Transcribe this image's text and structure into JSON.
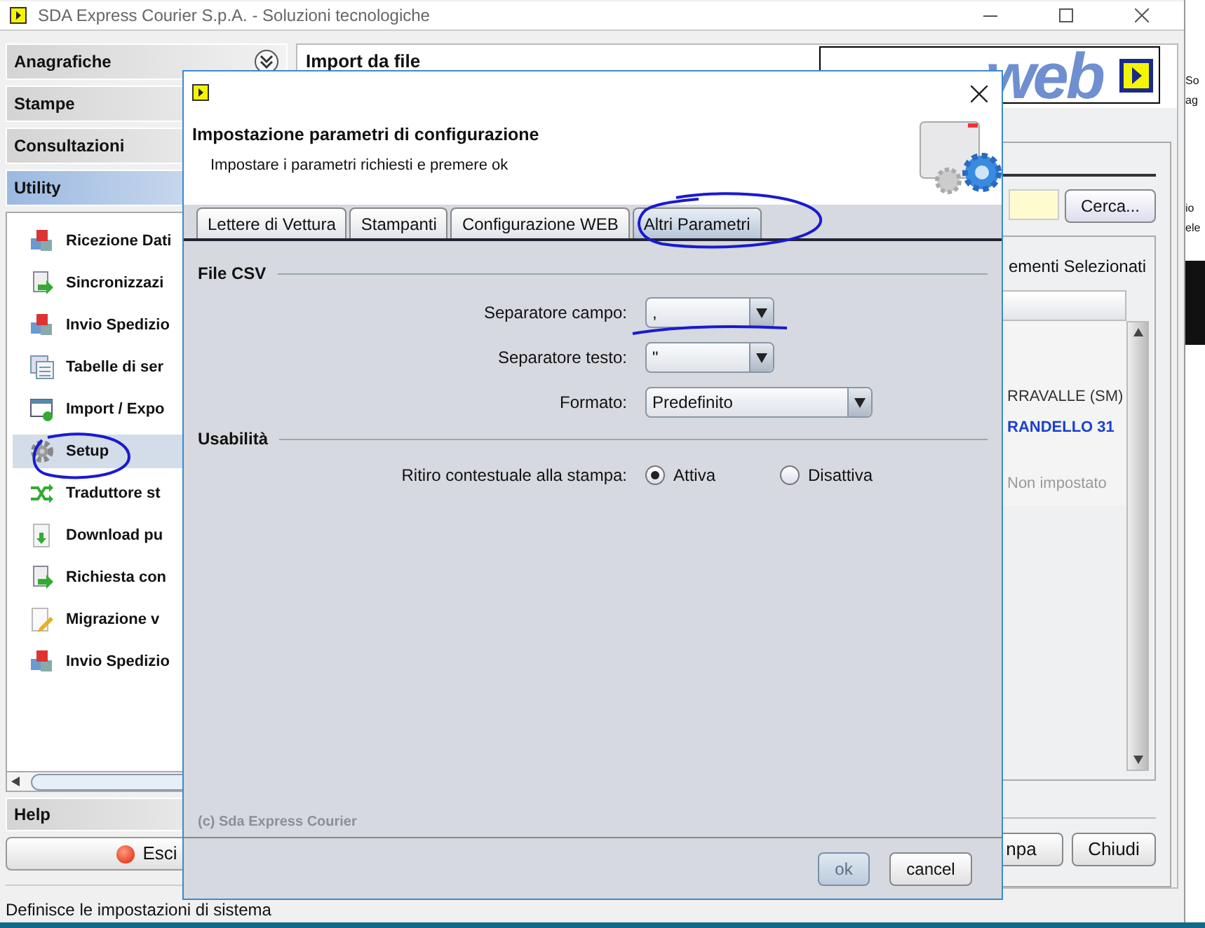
{
  "window": {
    "title": "SDA Express Courier S.p.A. - Soluzioni tecnologiche"
  },
  "sidebar": {
    "sections": [
      {
        "label": "Anagrafiche",
        "selected": false
      },
      {
        "label": "Stampe",
        "selected": false
      },
      {
        "label": "Consultazioni",
        "selected": false
      },
      {
        "label": "Utility",
        "selected": true
      }
    ],
    "items": [
      {
        "label": "Ricezione Dati",
        "kind": "cubes",
        "selected": false
      },
      {
        "label": "Sincronizzazi",
        "kind": "document",
        "selected": false
      },
      {
        "label": "Invio Spedizio",
        "kind": "cubes",
        "selected": false
      },
      {
        "label": "Tabelle di ser",
        "kind": "table",
        "selected": false
      },
      {
        "label": "Import / Expo",
        "kind": "window",
        "selected": false
      },
      {
        "label": "Setup",
        "kind": "gear",
        "selected": true
      },
      {
        "label": "Traduttore st",
        "kind": "shuffle",
        "selected": false
      },
      {
        "label": "Download pu",
        "kind": "download",
        "selected": false
      },
      {
        "label": "Richiesta con",
        "kind": "document",
        "selected": false
      },
      {
        "label": "Migrazione v",
        "kind": "edit",
        "selected": false
      },
      {
        "label": "Invio Spedizio",
        "kind": "cubes",
        "selected": false
      }
    ],
    "help": "Help",
    "exit_button": "Esci"
  },
  "main": {
    "title": "Import da file",
    "logo": "web",
    "search_button": "Cerca...",
    "list_title": "ementi Selezionati",
    "rows": [
      {
        "text": "RRAVALLE (SM)",
        "kind": "plain"
      },
      {
        "text": "RANDELLO 31",
        "kind": "link"
      },
      {
        "text": "Non impostato",
        "kind": "muted"
      }
    ],
    "buttons": [
      "npa",
      "Chiudi"
    ]
  },
  "status_bar": "Definisce le impostazioni di sistema",
  "desktop": [
    "So",
    "ag",
    "io",
    "ele"
  ],
  "dialog": {
    "title": "Impostazione parametri di configurazione",
    "subtitle": "Impostare i parametri richiesti e premere ok",
    "tabs": [
      {
        "label": "Lettere di Vettura",
        "selected": false
      },
      {
        "label": "Stampanti",
        "selected": false
      },
      {
        "label": "Configurazione WEB",
        "selected": false
      },
      {
        "label": "Altri Parametri",
        "selected": true
      }
    ],
    "sections": [
      {
        "title": "File CSV",
        "fields": [
          {
            "label": "Separatore campo:",
            "kind": "short_select",
            "value": ","
          },
          {
            "label": "Separatore testo:",
            "kind": "short_select",
            "value": "\""
          },
          {
            "label": "Formato:",
            "kind": "long_select",
            "value": "Predefinito"
          }
        ]
      },
      {
        "title": "Usabilità",
        "fields": [
          {
            "label": "Ritiro contestuale alla stampa:",
            "kind": "radio",
            "options": [
              {
                "label": "Attiva",
                "selected": true
              },
              {
                "label": "Disattiva",
                "selected": false
              }
            ]
          }
        ]
      }
    ],
    "copyright": "(c) Sda Express Courier",
    "buttons": [
      {
        "label": "ok",
        "disabled": true
      },
      {
        "label": "cancel",
        "disabled": false
      }
    ]
  }
}
